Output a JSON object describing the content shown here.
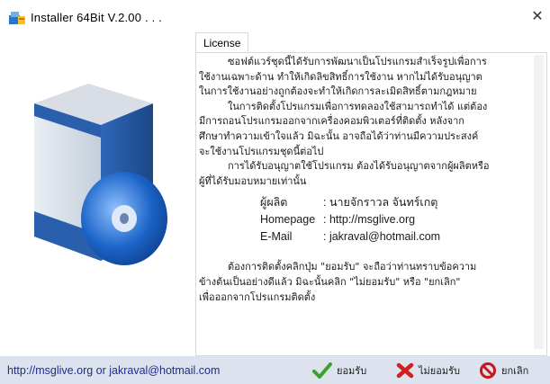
{
  "window": {
    "title": "Installer 64Bit V.2.00 . . ."
  },
  "tab": {
    "label": "License"
  },
  "license": {
    "p1_lines": [
      "ซอฟต์แวร์ชุดนี้ได้รับการพัฒนาเป็นโปรแกรมสำเร็จรูปเพื่อการ",
      "ใช้งานเฉพาะด้าน ทำให้เกิดลิขสิทธิ์การใช้งาน หากไม่ได้รับอนุญาต",
      "ในการใช้งานอย่างถูกต้องจะทำให้เกิดการละเมิดสิทธิ์ตามกฎหมาย",
      "ในการติดตั้งโปรแกรมเพื่อการทดลองใช้สามารถทำได้ แต่ต้อง",
      "มีการถอนโปรแกรมออกจากเครื่องคอมพิวเตอร์ที่ติดตั้ง หลังจาก",
      "ศึกษาทำความเข้าใจแล้ว มิฉะนั้น อาจถือได้ว่าท่านมีความประสงค์",
      "จะใช้งานโปรแกรมชุดนี้ต่อไป",
      "การได้รับอนุญาตใช้โปรแกรม ต้องได้รับอนุญาตจากผู้ผลิตหรือ",
      "ผู้ที่ได้รับมอบหมายเท่านั้น"
    ],
    "producer_key": "ผู้ผลิต",
    "producer_val": ": นายจักราวล จันทร์เกตุ",
    "homepage_key": "Homepage",
    "homepage_val": ": http://msglive.org",
    "email_key": "E-Mail",
    "email_val": ": jakraval@hotmail.com",
    "p3_lines": [
      "ต้องการติดตั้งคลิกปุ่ม \"ยอมรับ\" จะถือว่าท่านทราบข้อความ",
      "ข้างต้นเป็นอย่างดีแล้ว มิฉะนั้นคลิก \"ไม่ยอมรับ\" หรือ \"ยกเลิก\"",
      "เพื่อออกจากโปรแกรมติดตั้ง"
    ]
  },
  "footer": {
    "link": "http://msglive.org or jakraval@hotmail.com",
    "accept": "ยอมรับ",
    "decline": "ไม่ยอมรับ",
    "cancel": "ยกเลิก"
  },
  "colors": {
    "footer_bg": "#dce3ee",
    "link": "#1f2b8f",
    "accept": "#3aa22a",
    "decline": "#d11f1f",
    "cancel": "#c8161d"
  }
}
